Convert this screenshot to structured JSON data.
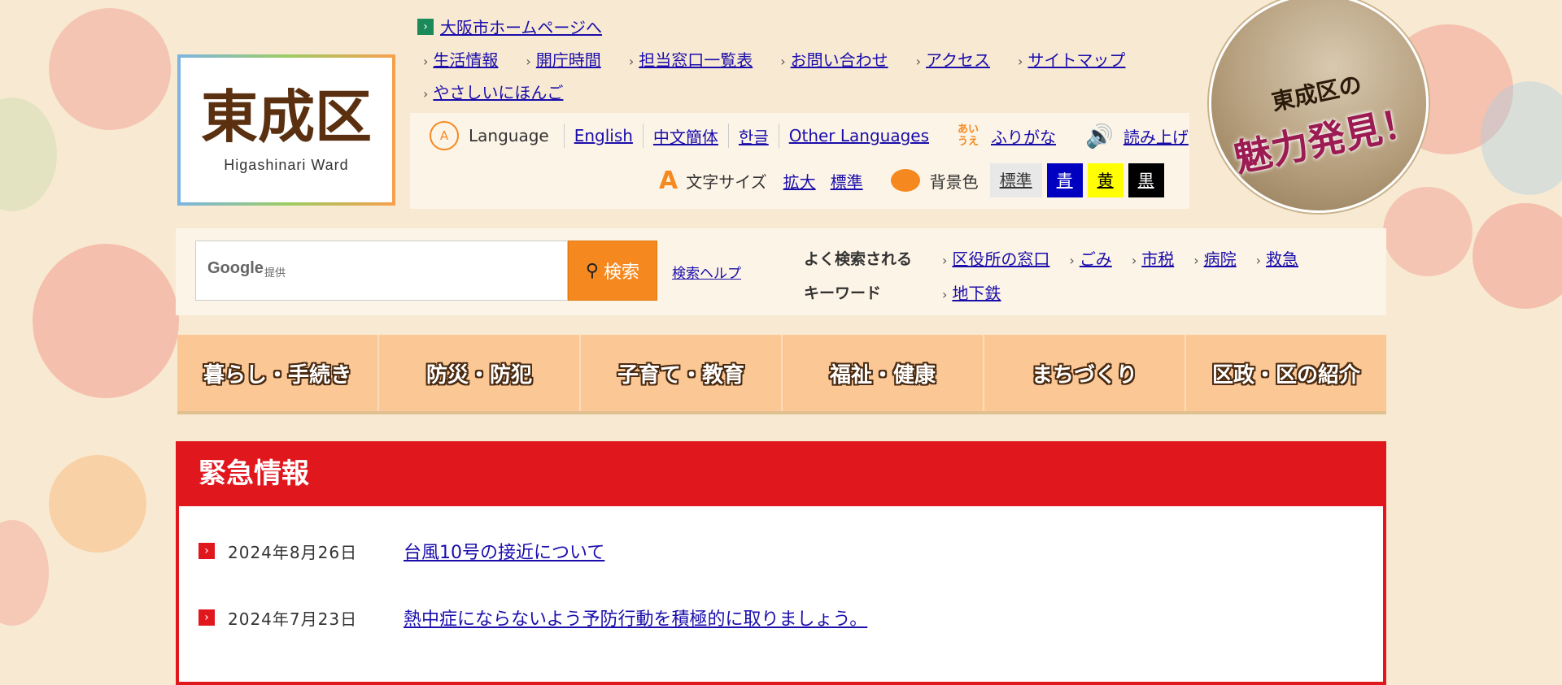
{
  "logo": {
    "kanji": "東成区",
    "en": "Higashinari Ward"
  },
  "top": {
    "osaka_link": "大阪市ホームページへ",
    "links": [
      "生活情報",
      "開庁時間",
      "担当窓口一覧表",
      "お問い合わせ",
      "アクセス",
      "サイトマップ"
    ],
    "easy_japanese": "やさしいにほんご"
  },
  "util": {
    "language_label": "Language",
    "languages": [
      "English",
      "中文簡体",
      "한글",
      "Other Languages"
    ],
    "furigana_icon": "あいうえ",
    "furigana": "ふりがな",
    "read_aloud": "読み上げ",
    "font_size_label": "文字サイズ",
    "font_size_options": [
      "拡大",
      "標準"
    ],
    "bg_color_label": "背景色",
    "bg_colors": [
      {
        "label": "標準",
        "bg": "#e8e8e8",
        "fg": "#333333"
      },
      {
        "label": "青",
        "bg": "#0000c0",
        "fg": "#ffffff"
      },
      {
        "label": "黄",
        "bg": "#ffff00",
        "fg": "#000000"
      },
      {
        "label": "黒",
        "bg": "#000000",
        "fg": "#ffffff"
      }
    ]
  },
  "search": {
    "google": "Google",
    "provided": "提供",
    "button": "検索",
    "help": "検索ヘルプ",
    "keywords_label_1": "よく検索される",
    "keywords_label_2": "キーワード",
    "keywords": [
      "区役所の窓口",
      "ごみ",
      "市税",
      "病院",
      "救急",
      "地下鉄"
    ]
  },
  "nav": [
    "暮らし・手続き",
    "防災・防犯",
    "子育て・教育",
    "福祉・健康",
    "まちづくり",
    "区政・区の紹介"
  ],
  "emergency": {
    "title": "緊急情報",
    "items": [
      {
        "date": "2024年8月26日",
        "title": "台風10号の接近について"
      },
      {
        "date": "2024年7月23日",
        "title": "熱中症にならないよう予防行動を積極的に取りましょう。"
      }
    ]
  },
  "badge": {
    "line1": "東成区の",
    "line2": "魅力発見！"
  },
  "colors": {
    "accent": "#e0181e",
    "search_btn": "#f5891f",
    "nav_bg": "#fbc895",
    "page_bg": "#f8ead2"
  }
}
